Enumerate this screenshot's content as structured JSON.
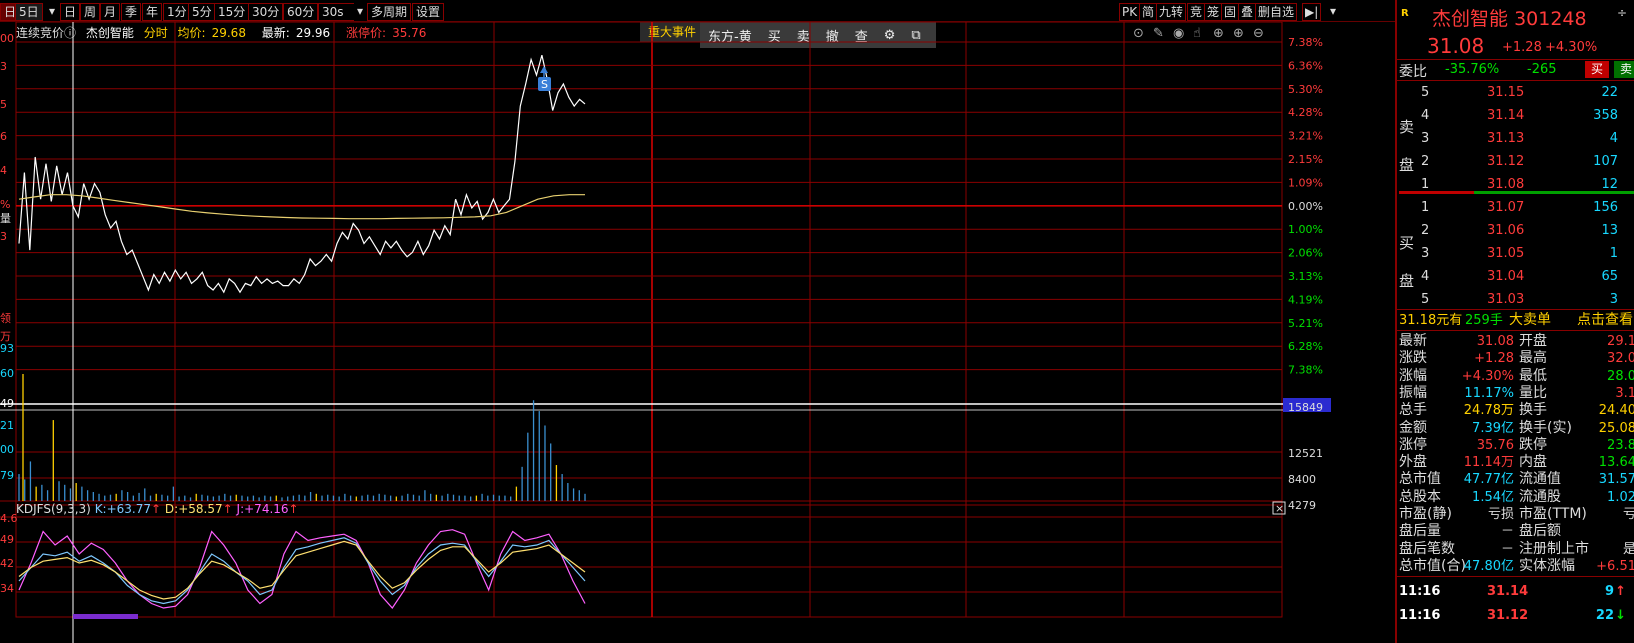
{
  "toolbar": {
    "left_items": [
      "日",
      "5日",
      "日",
      "周",
      "月",
      "季",
      "年",
      "1分",
      "5分",
      "15分",
      "30分",
      "60分",
      "30s",
      "多周期",
      "设置"
    ],
    "right_items": [
      "PK",
      "简",
      "九转",
      "竞",
      "笼",
      "固",
      "叠",
      "删自选",
      "▶|"
    ]
  },
  "info": {
    "auction": "连续竞价",
    "name": "杰创智能",
    "mode": "分时",
    "avg_label": "均价:",
    "avg": "29.68",
    "latest_label": "最新:",
    "latest": "29.96",
    "limit_label": "涨停价:",
    "limit": "35.76"
  },
  "event_button": "重大事件",
  "overlay_menu": [
    "东方-黄",
    "买",
    "卖",
    "撤",
    "查"
  ],
  "left_axis": {
    "main": [
      "00",
      "3",
      "5",
      "6",
      "4",
      "%",
      "3",
      "量",
      "领",
      "万"
    ],
    "volume": [
      "93",
      "60",
      "49",
      "21",
      "00",
      "79"
    ],
    "kdj": [
      "4.6",
      "49",
      "42",
      "34"
    ]
  },
  "price_axis": [
    "7.38%",
    "6.36%",
    "5.30%",
    "4.28%",
    "3.21%",
    "2.15%",
    "1.09%",
    "0.00%",
    "1.00%",
    "2.06%",
    "3.13%",
    "4.19%",
    "5.21%",
    "6.28%",
    "7.38%"
  ],
  "volume_axis": [
    "15849",
    "12521",
    "8400",
    "4279"
  ],
  "s_marker": "S",
  "kdj": {
    "name": "KDJFS(9,3,3)",
    "k_label": "K:",
    "k": "+63.77",
    "d_label": "D:",
    "d": "+58.57",
    "j_label": "J:",
    "j": "+74.16",
    "arrow": "↑"
  },
  "close_x": "×",
  "quote": {
    "logo": "R",
    "name": "杰创智能",
    "code": "301248",
    "price": "31.08",
    "change": "+1.28",
    "change_pct": "+4.30%",
    "weibi_label": "委比",
    "weibi_pct": "-35.76%",
    "weibi_val": "-265",
    "buy_btn": "买",
    "sell_btn": "卖",
    "sell_label": "卖盘",
    "buy_label": "买盘",
    "sells": [
      {
        "lvl": "5",
        "price": "31.15",
        "vol": "22"
      },
      {
        "lvl": "4",
        "price": "31.14",
        "vol": "358"
      },
      {
        "lvl": "3",
        "price": "31.13",
        "vol": "4"
      },
      {
        "lvl": "2",
        "price": "31.12",
        "vol": "107"
      },
      {
        "lvl": "1",
        "price": "31.08",
        "vol": "12"
      }
    ],
    "buys": [
      {
        "lvl": "1",
        "price": "31.07",
        "vol": "156"
      },
      {
        "lvl": "2",
        "price": "31.06",
        "vol": "13"
      },
      {
        "lvl": "3",
        "price": "31.05",
        "vol": "1"
      },
      {
        "lvl": "4",
        "price": "31.04",
        "vol": "65"
      },
      {
        "lvl": "5",
        "price": "31.03",
        "vol": "3"
      }
    ],
    "big_order": {
      "price": "31.18元有",
      "hands": "259手",
      "label": "大卖单",
      "link": "点击查看"
    },
    "stats": [
      {
        "l": "最新",
        "v": "31.08",
        "vc": "red",
        "l2": "开盘",
        "v2": "29.1",
        "v2c": "red"
      },
      {
        "l": "涨跌",
        "v": "+1.28",
        "vc": "red",
        "l2": "最高",
        "v2": "32.0",
        "v2c": "red"
      },
      {
        "l": "涨幅",
        "v": "+4.30%",
        "vc": "red",
        "l2": "最低",
        "v2": "28.0",
        "v2c": "grn"
      },
      {
        "l": "振幅",
        "v": "11.17%",
        "vc": "cyan",
        "l2": "量比",
        "v2": "3.1",
        "v2c": "red"
      },
      {
        "l": "总手",
        "v": "24.78万",
        "vc": "yel",
        "l2": "换手",
        "v2": "24.40",
        "v2c": "yel"
      },
      {
        "l": "金额",
        "v": "7.39亿",
        "vc": "cyan",
        "l2": "换手(实)",
        "v2": "25.08",
        "v2c": "yel"
      },
      {
        "l": "涨停",
        "v": "35.76",
        "vc": "red",
        "l2": "跌停",
        "v2": "23.8",
        "v2c": "grn"
      },
      {
        "l": "外盘",
        "v": "11.14万",
        "vc": "red",
        "l2": "内盘",
        "v2": "13.64",
        "v2c": "grn"
      },
      {
        "l": "总市值",
        "v": "47.77亿",
        "vc": "cyan",
        "l2": "流通值",
        "v2": "31.57",
        "v2c": "cyan"
      },
      {
        "l": "总股本",
        "v": "1.54亿",
        "vc": "cyan",
        "l2": "流通股",
        "v2": "1.02",
        "v2c": "cyan"
      },
      {
        "l": "市盈(静)",
        "v": "亏损",
        "vc": "wht",
        "l2": "市盈(TTM)",
        "v2": "亏",
        "v2c": "wht"
      },
      {
        "l": "盘后量",
        "v": "－",
        "vc": "wht",
        "l2": "盘后额",
        "v2": "",
        "v2c": "wht"
      },
      {
        "l": "盘后笔数",
        "v": "－",
        "vc": "wht",
        "l2": "注册制上市",
        "v2": "是",
        "v2c": "wht"
      },
      {
        "l": "总市值(合)",
        "v": "47.80亿",
        "vc": "cyan",
        "l2": "实体涨幅",
        "v2": "+6.51",
        "v2c": "red"
      }
    ],
    "ticks": [
      {
        "time": "11:16",
        "price": "31.14",
        "vol": "9",
        "arrow": "↑"
      },
      {
        "time": "11:16",
        "price": "31.12",
        "vol": "22",
        "arrow": "↓"
      }
    ]
  },
  "colors": {
    "grid": "#8a0000",
    "price_line": "#ffffff",
    "avg_line": "#e8d070",
    "vol_bar": "#3a8fd0",
    "k": "#7ec8ff",
    "d": "#ffe070",
    "j": "#ff60ff"
  }
}
